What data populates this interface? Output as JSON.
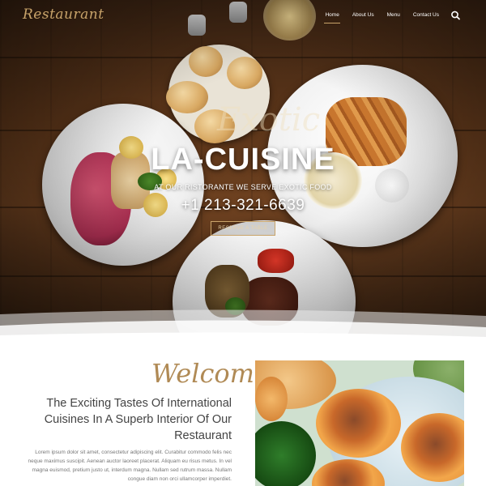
{
  "header": {
    "logo": "Restaurant",
    "nav": [
      "Home",
      "About Us",
      "Menu",
      "Contact Us"
    ],
    "active": "Home"
  },
  "hero": {
    "script_text": "Exotic",
    "title": "LA-CUISINE",
    "subtitle": "AT OUR RISTORANTE WE SERVE EXOTIC FOOD",
    "phone": "+1 213-321-6639",
    "button_label": "RESERVE A TABLE"
  },
  "welcome": {
    "script_heading": "Welcome",
    "heading_lines": [
      "The Exciting Tastes Of International",
      "Cuisines In A Superb Interior Of Our",
      "Restaurant"
    ],
    "body_lines": [
      "Lorem ipsum dolor sit amet, consectetur adipiscing elit. Curabitur commodo felis nec",
      "neque maximus suscipit. Aenean auctor laoreet placerat. Aliquam eu risus metus. In vel",
      "magna euismod, pretium justo ut, interdum magna. Nullam sed rutrum massa. Nullam",
      "congue diam non orci ullamcorper imperdiet."
    ]
  },
  "colors": {
    "accent": "#c9a46a",
    "heading": "#444444",
    "body_text": "#777777"
  },
  "icons": {
    "search": "search-icon"
  }
}
